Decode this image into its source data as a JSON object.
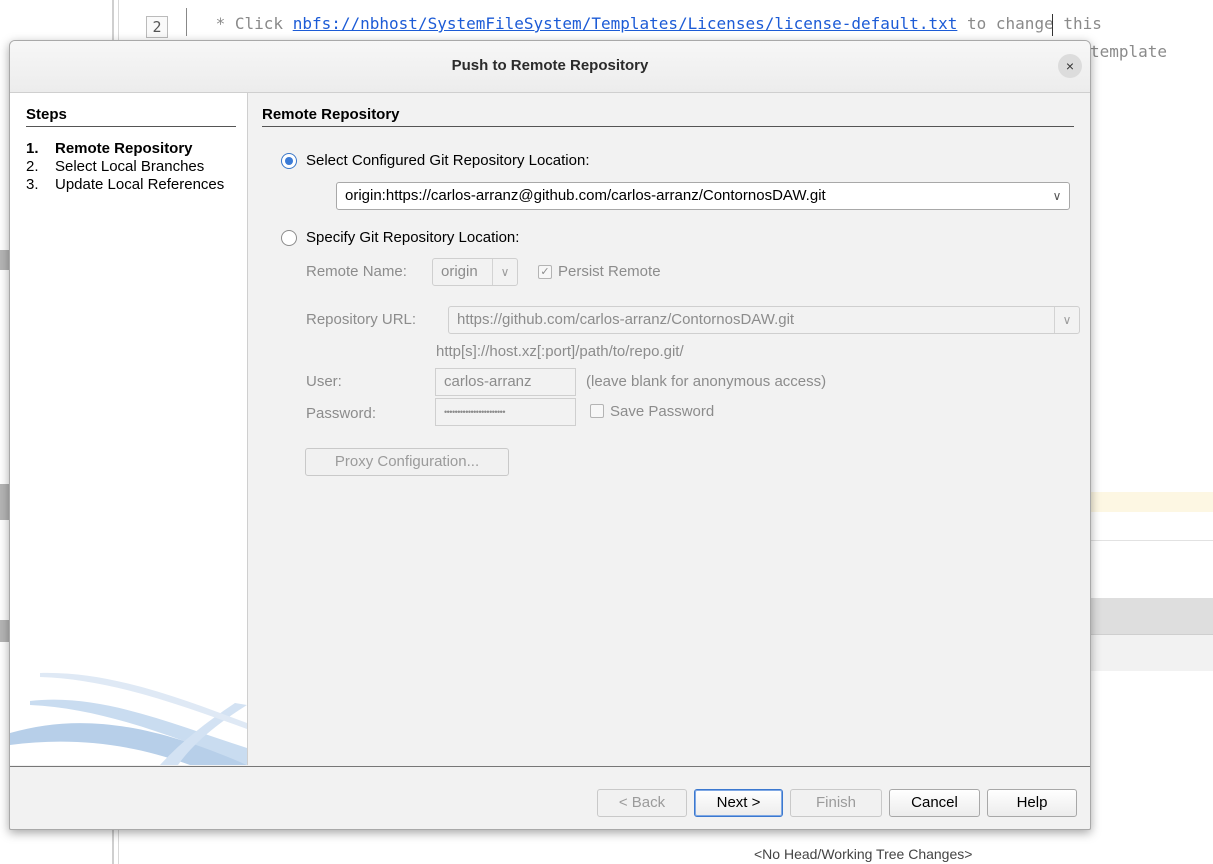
{
  "editor": {
    "line_number": "2",
    "code_prefix": " * Click ",
    "code_link": "nbfs://nbhost/SystemFileSystem/Templates/Licenses/license-default.txt",
    "code_suffix": " to change this",
    "code_line2_tail": "template",
    "status_text": "<No Head/Working Tree Changes>"
  },
  "dialog": {
    "title": "Push to Remote Repository",
    "close_glyph": "×",
    "steps": {
      "title": "Steps",
      "items": [
        {
          "num": "1.",
          "label": "Remote Repository",
          "active": true
        },
        {
          "num": "2.",
          "label": "Select Local Branches",
          "active": false
        },
        {
          "num": "3.",
          "label": "Update Local References",
          "active": false
        }
      ]
    },
    "section_title": "Remote Repository",
    "configured": {
      "label": "Select Configured Git Repository Location:",
      "selected": true,
      "value": "origin:https://carlos-arranz@github.com/carlos-arranz/ContornosDAW.git"
    },
    "specify": {
      "label": "Specify Git Repository Location:",
      "selected": false,
      "remote_name_label": "Remote Name:",
      "remote_name_value": "origin",
      "persist_remote_label": "Persist Remote",
      "persist_remote_checked": "✓",
      "repository_url_label": "Repository URL:",
      "repository_url_value": "https://github.com/carlos-arranz/ContornosDAW.git",
      "url_hint": "http[s]://host.xz[:port]/path/to/repo.git/",
      "user_label": "User:",
      "user_value": "carlos-arranz",
      "user_hint": "(leave blank for anonymous access)",
      "password_label": "Password:",
      "password_value": "•••••••••••••••••••••••",
      "save_password_label": "Save Password",
      "proxy_button": "Proxy Configuration..."
    },
    "buttons": {
      "back": "< Back",
      "next": "Next >",
      "finish": "Finish",
      "cancel": "Cancel",
      "help": "Help"
    },
    "icons": {
      "combo_arrow": "∨"
    },
    "colors": {
      "accent": "#3b7bd6",
      "disabled_text": "#8c8c8c"
    }
  }
}
